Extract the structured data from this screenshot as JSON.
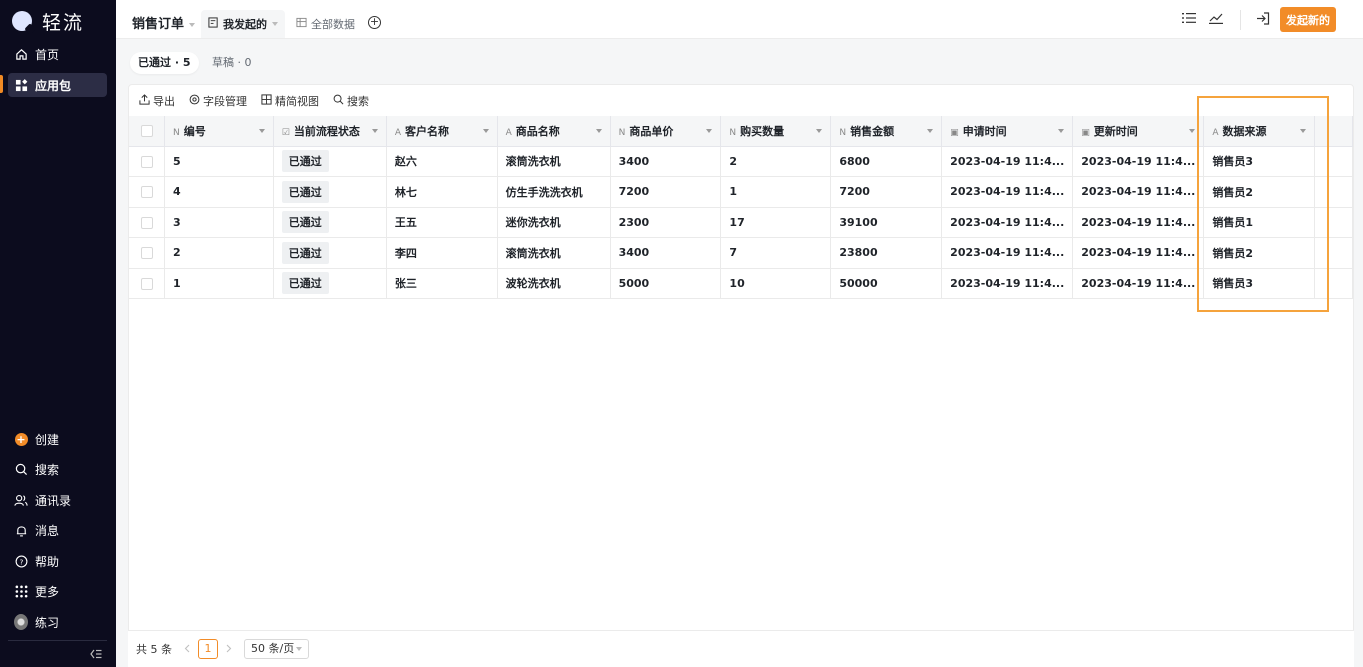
{
  "brand": {
    "name": "轻流"
  },
  "sidebar": {
    "top_items": [
      {
        "label": "首页",
        "icon": "home-icon"
      },
      {
        "label": "应用包",
        "icon": "apps-icon",
        "active": true
      }
    ],
    "bottom_items": [
      {
        "label": "创建",
        "icon": "create-plus-icon"
      },
      {
        "label": "搜索",
        "icon": "search-icon"
      },
      {
        "label": "通讯录",
        "icon": "contacts-icon"
      },
      {
        "label": "消息",
        "icon": "bell-icon"
      },
      {
        "label": "帮助",
        "icon": "help-icon"
      },
      {
        "label": "更多",
        "icon": "grid-dots-icon"
      },
      {
        "label": "练习",
        "icon": "practice-icon"
      }
    ]
  },
  "topbar": {
    "title": "销售订单",
    "views": [
      {
        "label": "我发起的",
        "selected": true
      },
      {
        "label": "全部数据",
        "selected": false
      }
    ],
    "primary_button": "发起新的"
  },
  "status_tabs": [
    {
      "label": "已通过 · 5",
      "selected": true
    },
    {
      "label": "草稿 · 0",
      "selected": false
    }
  ],
  "toolbar": {
    "export": "导出",
    "fields": "字段管理",
    "compact_view": "精简视图",
    "search": "搜索"
  },
  "table": {
    "columns": [
      {
        "label": "编号",
        "icon": "N"
      },
      {
        "label": "当前流程状态",
        "icon": "☑"
      },
      {
        "label": "客户名称",
        "icon": "A"
      },
      {
        "label": "商品名称",
        "icon": "A"
      },
      {
        "label": "商品单价",
        "icon": "N"
      },
      {
        "label": "购买数量",
        "icon": "N"
      },
      {
        "label": "销售金额",
        "icon": "N"
      },
      {
        "label": "申请时间",
        "icon": "▣"
      },
      {
        "label": "更新时间",
        "icon": "▣"
      },
      {
        "label": "数据来源",
        "icon": "A"
      }
    ],
    "rows": [
      [
        "5",
        "已通过",
        "赵六",
        "滚筒洗衣机",
        "3400",
        "2",
        "6800",
        "2023-04-19 11:4...",
        "2023-04-19 11:4...",
        "销售员3"
      ],
      [
        "4",
        "已通过",
        "林七",
        "仿生手洗洗衣机",
        "7200",
        "1",
        "7200",
        "2023-04-19 11:4...",
        "2023-04-19 11:4...",
        "销售员2"
      ],
      [
        "3",
        "已通过",
        "王五",
        "迷你洗衣机",
        "2300",
        "17",
        "39100",
        "2023-04-19 11:4...",
        "2023-04-19 11:4...",
        "销售员1"
      ],
      [
        "2",
        "已通过",
        "李四",
        "滚筒洗衣机",
        "3400",
        "7",
        "23800",
        "2023-04-19 11:4...",
        "2023-04-19 11:4...",
        "销售员2"
      ],
      [
        "1",
        "已通过",
        "张三",
        "波轮洗衣机",
        "5000",
        "10",
        "50000",
        "2023-04-19 11:4...",
        "2023-04-19 11:4...",
        "销售员3"
      ]
    ]
  },
  "footer": {
    "total": "共 5 条",
    "page": "1",
    "page_size": "50 条/页"
  },
  "colors": {
    "accent": "#f28c28",
    "sidebar_bg": "#0c0c1e",
    "highlight": "#f5a33c"
  }
}
